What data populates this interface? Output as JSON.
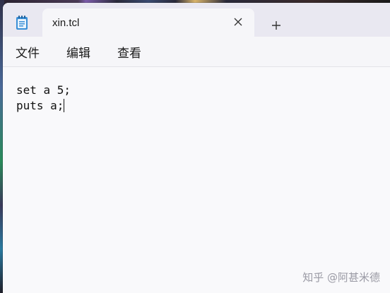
{
  "tab": {
    "title": "xin.tcl",
    "icon": "notepad-icon",
    "close_icon": "close-icon",
    "new_tab_icon": "plus-icon"
  },
  "menu": {
    "items": [
      {
        "label": "文件"
      },
      {
        "label": "编辑"
      },
      {
        "label": "查看"
      }
    ]
  },
  "editor": {
    "lines": [
      "set a 5;",
      "puts a;"
    ]
  },
  "watermark": "知乎 @阿甚米德",
  "colors": {
    "accent_icon": "#3a8fd6",
    "tabbar_bg": "#e9e8f1",
    "editor_bg": "#f9f9fb"
  }
}
